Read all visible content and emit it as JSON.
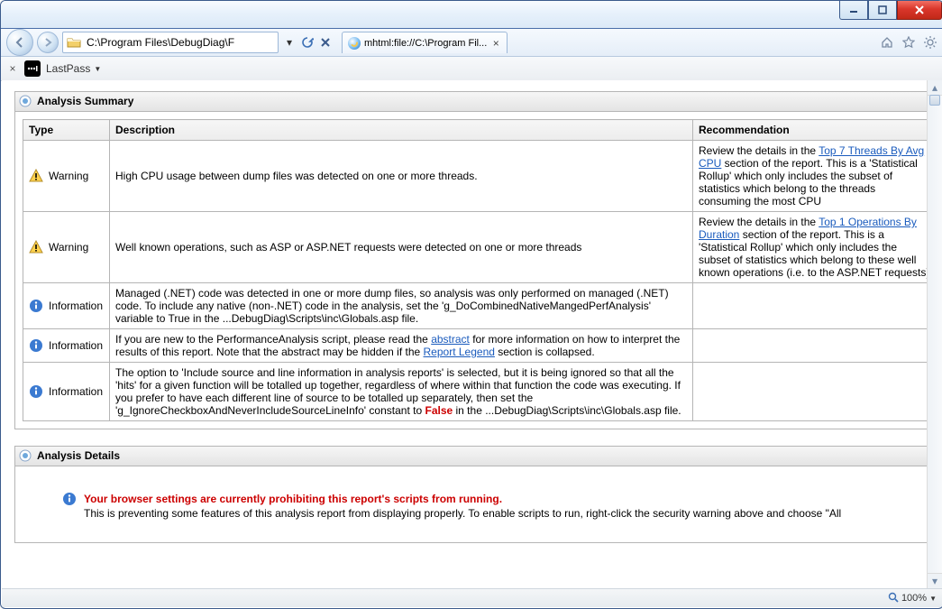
{
  "window": {
    "address": "C:\\Program Files\\DebugDiag\\F",
    "tab_title": "mhtml:file://C:\\Program Fil...",
    "zoom": "100%"
  },
  "toolbar": {
    "lastpass_label": "LastPass"
  },
  "sections": {
    "summary_title": "Analysis Summary",
    "details_title": "Analysis Details"
  },
  "table": {
    "headers": {
      "type": "Type",
      "desc": "Description",
      "rec": "Recommendation"
    },
    "rows": [
      {
        "kind": "warning",
        "type_label": "Warning",
        "desc": "High CPU usage between dump files was detected on one or more threads.",
        "rec_pre": "Review the details in the ",
        "rec_link": "Top 7 Threads By Avg CPU",
        "rec_post": " section of the report. This is a 'Statistical Rollup' which only includes the subset of statistics which belong to the threads consuming the most CPU"
      },
      {
        "kind": "warning",
        "type_label": "Warning",
        "desc": "Well known operations, such as ASP or ASP.NET requests were detected on one or more threads",
        "rec_pre": "Review the details in the ",
        "rec_link": "Top 1 Operations By Duration",
        "rec_post": " section of the report. This is a 'Statistical Rollup' which only includes the subset of statistics which belong to these well known operations (i.e. to the ASP.NET requests)"
      },
      {
        "kind": "info",
        "type_label": "Information",
        "desc": "Managed (.NET) code was detected in one or more dump files, so analysis was only performed on managed (.NET) code. To include any native (non-.NET) code in the analysis, set the 'g_DoCombinedNativeMangedPerfAnalysis' variable to True in the ...DebugDiag\\Scripts\\inc\\Globals.asp file.",
        "rec_pre": "",
        "rec_link": "",
        "rec_post": ""
      },
      {
        "kind": "info",
        "type_label": "Information",
        "desc_pre": "If you are new to the PerformanceAnalysis script, please read the ",
        "desc_link1": "abstract",
        "desc_mid": " for more information on how to interpret the results of this report.   Note that the abstract may be hidden if the ",
        "desc_link2": "Report Legend",
        "desc_post": " section is collapsed.",
        "rec_pre": "",
        "rec_link": "",
        "rec_post": ""
      },
      {
        "kind": "info",
        "type_label": "Information",
        "desc_pre": "The option to 'Include source and line information in analysis reports' is selected, but it is being ignored so that all the 'hits' for a given function will be totalled up together, regardless of where within that function the code was executing. If you prefer to have each different line of source to be totalled up separately, then set the 'g_IgnoreCheckboxAndNeverIncludeSourceLineInfo' constant to ",
        "desc_red": "False",
        "desc_post": " in the ...DebugDiag\\Scripts\\inc\\Globals.asp file.",
        "rec_pre": "",
        "rec_link": "",
        "rec_post": ""
      }
    ]
  },
  "details": {
    "line1": "Your browser settings are currently prohibiting this report's scripts from running.",
    "line2": "This is preventing some features of this analysis report from displaying properly. To enable scripts to run, right-click the security warning above and choose \"All"
  }
}
